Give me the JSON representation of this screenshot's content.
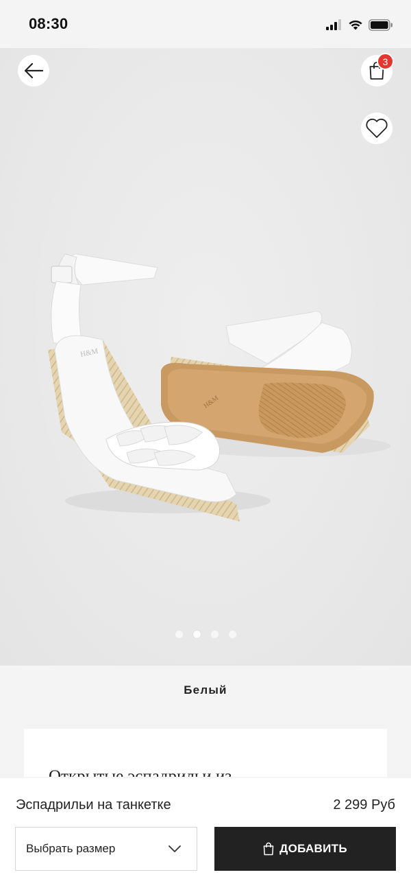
{
  "status_bar": {
    "time": "08:30",
    "icons": [
      "signal-icon",
      "wifi-icon",
      "battery-icon"
    ]
  },
  "hero": {
    "image": "white-wedge-espadrille-sandals",
    "brand_mark": "H&M",
    "cart_count": "3",
    "carousel": {
      "total": 4,
      "active_index": 1
    }
  },
  "product": {
    "color": "Белый",
    "description_preview": "Открытые эспадрильи из",
    "name": "Эспадрильи на танкетке",
    "price": "2 299 Руб"
  },
  "actions": {
    "size_placeholder": "Выбрать размер",
    "add_label": "ДОБАВИТЬ"
  },
  "colors": {
    "background": "#f4f4f4",
    "hero_background": "#e9e9e9",
    "badge": "#e2362e",
    "button_dark": "#222222"
  }
}
